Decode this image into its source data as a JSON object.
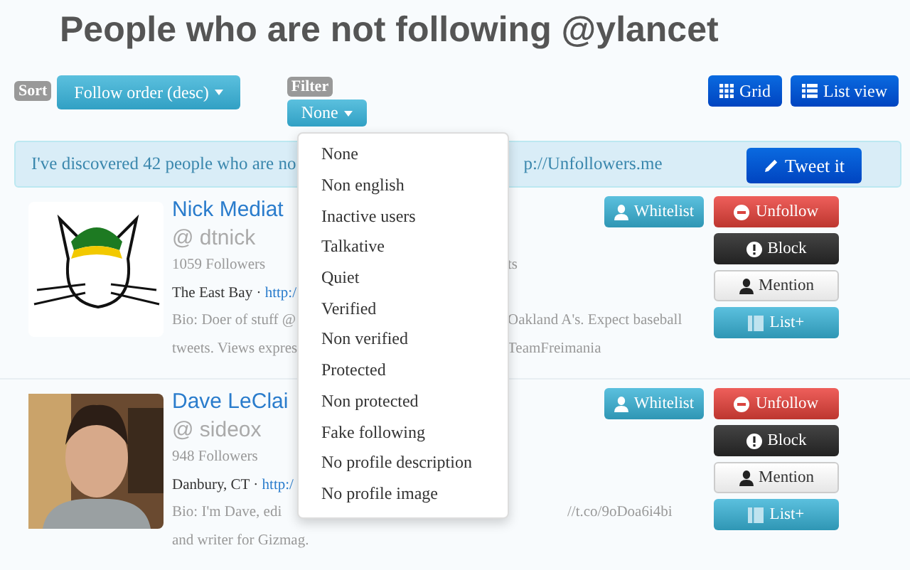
{
  "title": "People who are not following @ylancet",
  "sort": {
    "label": "Sort",
    "button": "Follow order (desc)"
  },
  "filter": {
    "label": "Filter",
    "button": "None",
    "menu": [
      "None",
      "Non english",
      "Inactive users",
      "Talkative",
      "Quiet",
      "Verified",
      "Non verified",
      "Protected",
      "Non protected",
      "Fake following",
      "No profile description",
      "No profile image"
    ]
  },
  "view_buttons": [
    {
      "label": "Grid",
      "kind": "grid"
    },
    {
      "label": "List view",
      "kind": "list"
    }
  ],
  "notice": {
    "text_left": "I've discovered 42 people who are no",
    "text_right": "p://Unfollowers.me",
    "button": "Tweet it"
  },
  "users": [
    {
      "name": "Nick Mediat",
      "handle": "@ dtnick",
      "followers": "1059 Followers",
      "followers_right": "ts",
      "location": "The East Bay ·",
      "link": "http:/",
      "bio": [
        {
          "left": "Bio: Doer of stuff @",
          "right": "Oakland A's. Expect baseball"
        },
        {
          "left": "tweets. Views expres",
          "right": "TeamFreimania"
        }
      ],
      "actions": [
        {
          "label": "Whitelist",
          "kind": "whitelist"
        },
        {
          "label": "Unfollow",
          "kind": "unfollow"
        },
        {
          "label": "Block",
          "kind": "block"
        },
        {
          "label": "Mention",
          "kind": "mention"
        },
        {
          "label": "List+",
          "kind": "list"
        }
      ]
    },
    {
      "name": "Dave LeClai",
      "handle": "@ sideox",
      "followers": "948 Followers",
      "location": "Danbury, CT ·",
      "link": "http:/",
      "bio": [
        {
          "left": "Bio: I'm Dave, edi",
          "right": "//t.co/9oDoa6i4bi"
        },
        {
          "left": "and writer for Gizmag."
        }
      ],
      "actions": [
        {
          "label": "Whitelist",
          "kind": "whitelist"
        },
        {
          "label": "Unfollow",
          "kind": "unfollow"
        },
        {
          "label": "Block",
          "kind": "block"
        },
        {
          "label": "Mention",
          "kind": "mention"
        },
        {
          "label": "List+",
          "kind": "list"
        }
      ]
    }
  ]
}
